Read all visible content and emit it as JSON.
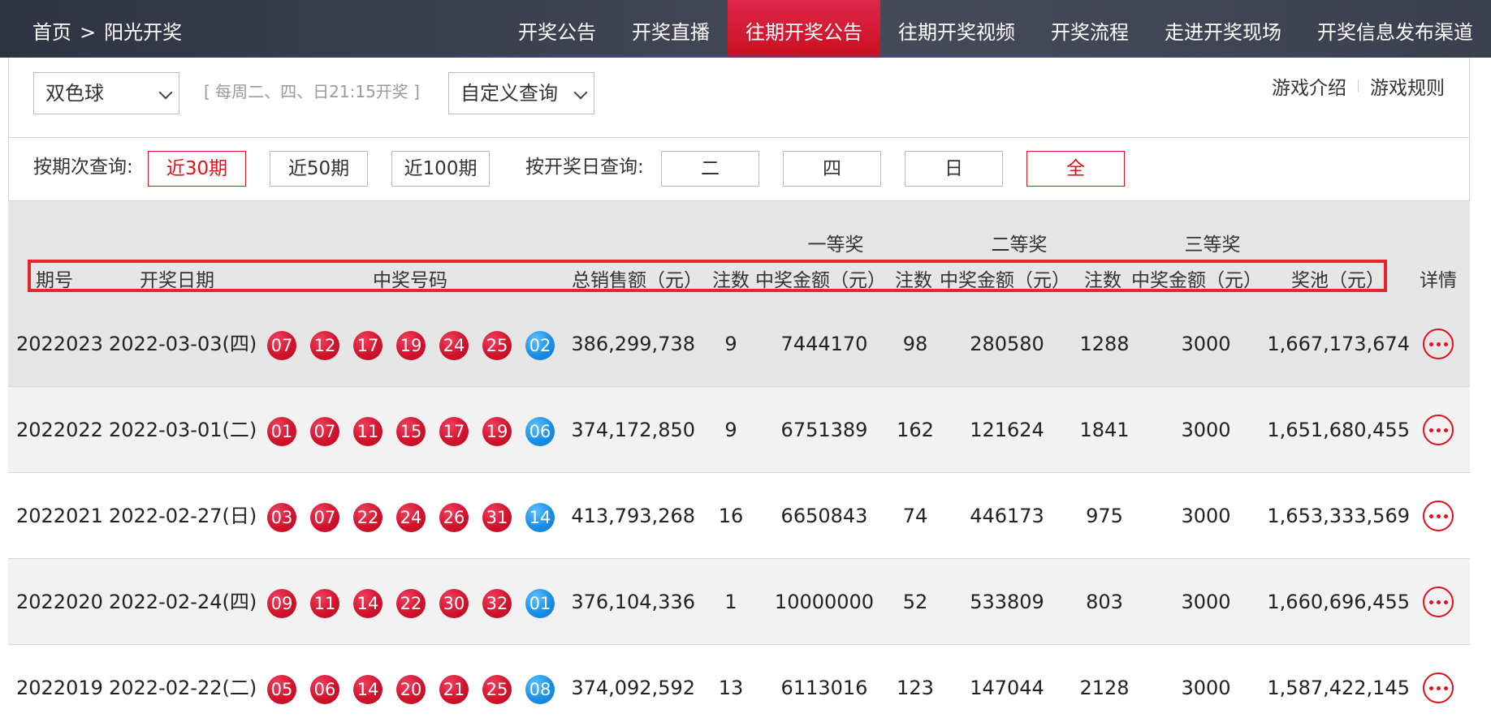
{
  "nav": {
    "breadcrumb": [
      "首页",
      ">",
      "阳光开奖"
    ],
    "items": [
      {
        "label": "开奖公告",
        "active": false
      },
      {
        "label": "开奖直播",
        "active": false
      },
      {
        "label": "往期开奖公告",
        "active": true
      },
      {
        "label": "往期开奖视频",
        "active": false
      },
      {
        "label": "开奖流程",
        "active": false
      },
      {
        "label": "走进开奖现场",
        "active": false
      },
      {
        "label": "开奖信息发布渠道",
        "active": false
      }
    ]
  },
  "filters": {
    "game_select": "双色球",
    "schedule_hint": "[ 每周二、四、日21:15开奖 ]",
    "query_select": "自定义查询",
    "links": [
      "游戏介绍",
      "游戏规则"
    ],
    "period_label": "按期次查询:",
    "periods": [
      "近30期",
      "近50期",
      "近100期"
    ],
    "day_label": "按开奖日查询:",
    "days": [
      "二",
      "四",
      "日",
      "全"
    ]
  },
  "table": {
    "groups": [
      "一等奖",
      "二等奖",
      "三等奖"
    ],
    "headers": [
      "期号",
      "开奖日期",
      "中奖号码",
      "总销售额（元）",
      "注数",
      "中奖金额（元）",
      "注数",
      "中奖金额（元）",
      "注数",
      "中奖金额（元）",
      "奖池（元）"
    ],
    "detail_header": "详情",
    "rows": [
      {
        "issue": "2022023",
        "date": "2022-03-03(四)",
        "red": [
          "07",
          "12",
          "17",
          "19",
          "24",
          "25"
        ],
        "blue": "02",
        "sales": "386,299,738",
        "n1": "9",
        "a1": "7444170",
        "n2": "98",
        "a2": "280580",
        "n3": "1288",
        "a3": "3000",
        "pool": "1,667,173,674"
      },
      {
        "issue": "2022022",
        "date": "2022-03-01(二)",
        "red": [
          "01",
          "07",
          "11",
          "15",
          "17",
          "19"
        ],
        "blue": "06",
        "sales": "374,172,850",
        "n1": "9",
        "a1": "6751389",
        "n2": "162",
        "a2": "121624",
        "n3": "1841",
        "a3": "3000",
        "pool": "1,651,680,455"
      },
      {
        "issue": "2022021",
        "date": "2022-02-27(日)",
        "red": [
          "03",
          "07",
          "22",
          "24",
          "26",
          "31"
        ],
        "blue": "14",
        "sales": "413,793,268",
        "n1": "16",
        "a1": "6650843",
        "n2": "74",
        "a2": "446173",
        "n3": "975",
        "a3": "3000",
        "pool": "1,653,333,569"
      },
      {
        "issue": "2022020",
        "date": "2022-02-24(四)",
        "red": [
          "09",
          "11",
          "14",
          "22",
          "30",
          "32"
        ],
        "blue": "01",
        "sales": "376,104,336",
        "n1": "1",
        "a1": "10000000",
        "n2": "52",
        "a2": "533809",
        "n3": "803",
        "a3": "3000",
        "pool": "1,660,696,455"
      },
      {
        "issue": "2022019",
        "date": "2022-02-22(二)",
        "red": [
          "05",
          "06",
          "14",
          "20",
          "21",
          "25"
        ],
        "blue": "08",
        "sales": "374,092,592",
        "n1": "13",
        "a1": "6113016",
        "n2": "123",
        "a2": "147044",
        "n3": "2128",
        "a3": "3000",
        "pool": "1,587,422,145"
      }
    ]
  },
  "colors": {
    "accent": "#e2101c",
    "red_ball": "#d2132c",
    "blue_ball": "#1a8fe8"
  }
}
